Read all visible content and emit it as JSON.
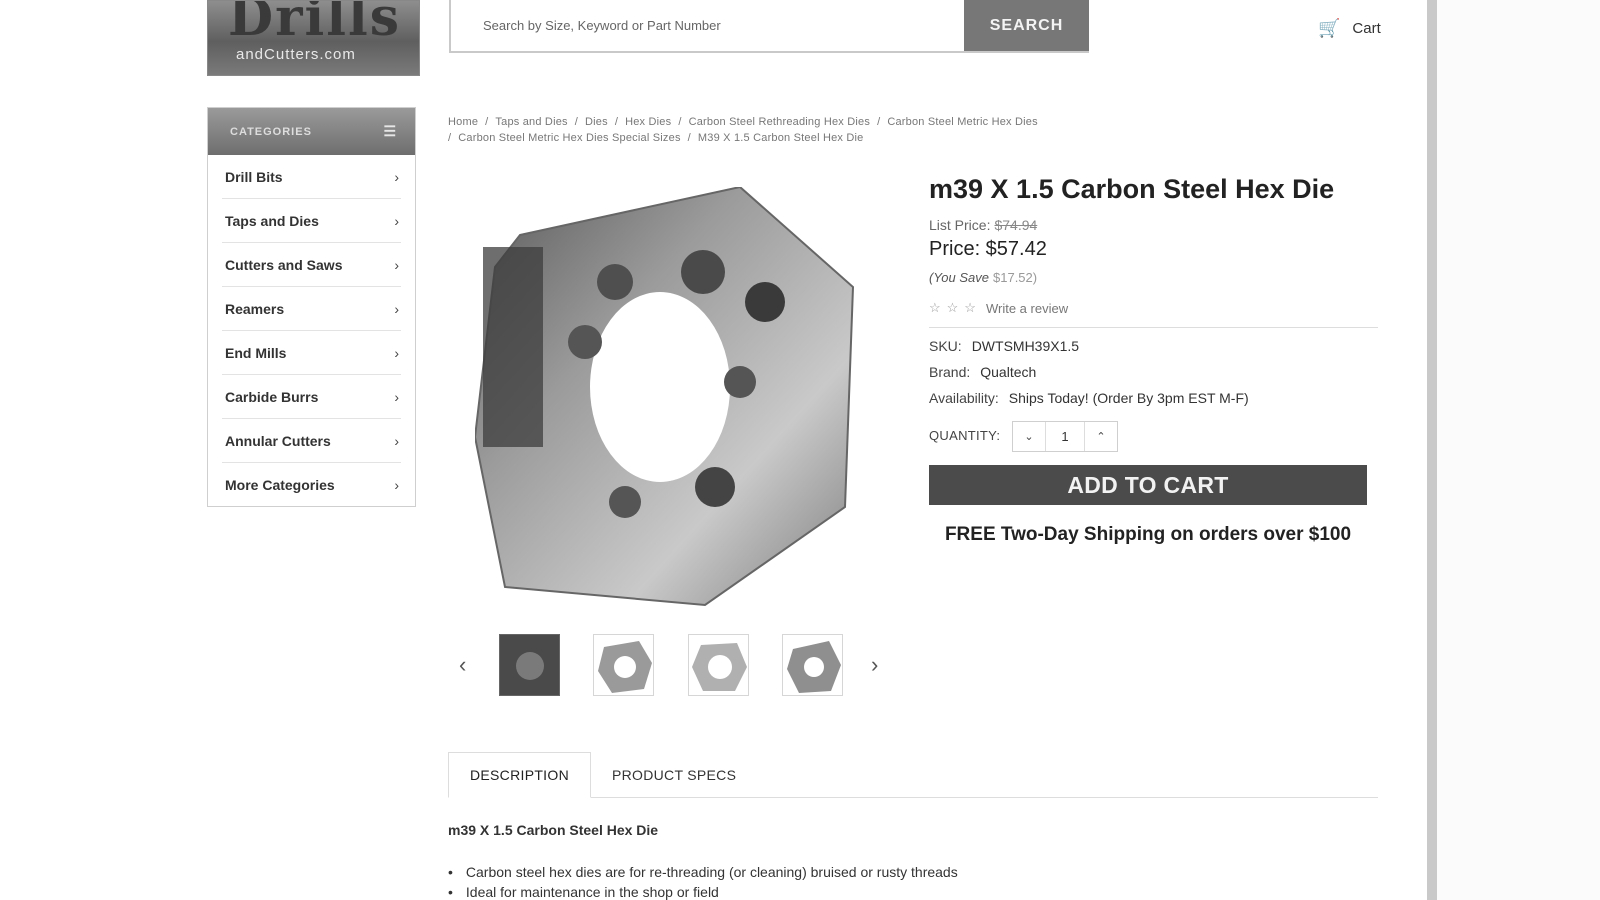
{
  "header": {
    "logo_main": "Drills",
    "logo_sub": "andCutters.com",
    "search_placeholder": "Search by Size, Keyword or Part Number",
    "search_button": "SEARCH",
    "cart_label": "Cart"
  },
  "sidebar": {
    "heading": "CATEGORIES",
    "items": [
      {
        "label": "Drill Bits"
      },
      {
        "label": "Taps and Dies"
      },
      {
        "label": "Cutters and Saws"
      },
      {
        "label": "Reamers"
      },
      {
        "label": "End Mills"
      },
      {
        "label": "Carbide Burrs"
      },
      {
        "label": "Annular Cutters"
      },
      {
        "label": "More Categories"
      }
    ]
  },
  "breadcrumb": [
    "Home",
    "Taps and Dies",
    "Dies",
    "Hex Dies",
    "Carbon Steel Rethreading Hex Dies",
    "Carbon Steel Metric Hex Dies",
    "Carbon Steel Metric Hex Dies Special Sizes",
    "M39 X 1.5 Carbon Steel Hex Die"
  ],
  "product": {
    "title": "m39 X 1.5 Carbon Steel Hex Die",
    "list_price_label": "List Price:",
    "list_price": "$74.94",
    "price": "Price: $57.42",
    "you_save_label": "(You Save",
    "you_save": "$17.52)",
    "review_link": "Write a review",
    "sku_label": "SKU:",
    "sku": "DWTSMH39X1.5",
    "brand_label": "Brand:",
    "brand": "Qualtech",
    "availability_label": "Availability:",
    "availability": "Ships Today! (Order By 3pm EST M-F)",
    "quantity_label": "QUANTITY:",
    "quantity": "1",
    "add_to_cart": "ADD TO CART",
    "free_shipping": "FREE Two-Day Shipping on orders over $100"
  },
  "tabs": [
    {
      "label": "DESCRIPTION"
    },
    {
      "label": "PRODUCT SPECS"
    }
  ],
  "description": {
    "heading": "m39 X 1.5 Carbon Steel Hex Die",
    "bullets": [
      "Carbon steel hex dies are for re-threading (or cleaning) bruised or rusty threads",
      "Ideal for maintenance in the shop or field"
    ]
  },
  "colors": {
    "button_dark": "#4b4b4b",
    "sidebar_header": "#7a7a7a",
    "search_button": "#777777"
  },
  "icons": [
    "cart-icon",
    "menu-icon",
    "chevron-right-icon",
    "chevron-left-icon",
    "chevron-down-icon",
    "chevron-up-icon",
    "star-icon"
  ]
}
